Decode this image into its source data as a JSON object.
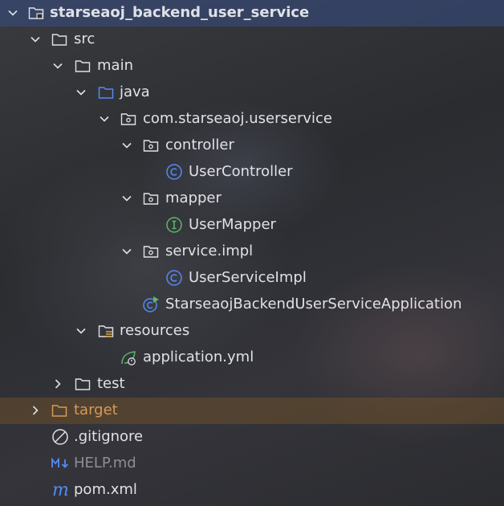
{
  "project_tree": {
    "items": [
      {
        "label": "starseaoj_backend_user_service",
        "icon": "module-folder-icon",
        "expanded": true,
        "selected": true
      },
      {
        "label": "src",
        "icon": "folder-icon",
        "expanded": true
      },
      {
        "label": "main",
        "icon": "folder-icon",
        "expanded": true
      },
      {
        "label": "java",
        "icon": "source-root-folder-icon",
        "expanded": true
      },
      {
        "label": "com.starseaoj.userservice",
        "icon": "package-icon",
        "expanded": true
      },
      {
        "label": "controller",
        "icon": "package-icon",
        "expanded": true
      },
      {
        "label": "UserController",
        "icon": "class-icon"
      },
      {
        "label": "mapper",
        "icon": "package-icon",
        "expanded": true
      },
      {
        "label": "UserMapper",
        "icon": "interface-icon"
      },
      {
        "label": "service.impl",
        "icon": "package-icon",
        "expanded": true
      },
      {
        "label": "UserServiceImpl",
        "icon": "class-icon"
      },
      {
        "label": "StarseaojBackendUserServiceApplication",
        "icon": "spring-boot-app-icon"
      },
      {
        "label": "resources",
        "icon": "resources-folder-icon",
        "expanded": true
      },
      {
        "label": "application.yml",
        "icon": "spring-config-icon"
      },
      {
        "label": "test",
        "icon": "folder-icon",
        "expanded": false
      },
      {
        "label": "target",
        "icon": "excluded-folder-icon",
        "expanded": false
      },
      {
        "label": ".gitignore",
        "icon": "ignore-file-icon"
      },
      {
        "label": "HELP.md",
        "icon": "markdown-icon"
      },
      {
        "label": "pom.xml",
        "icon": "maven-icon"
      }
    ]
  },
  "colors": {
    "selection": "#374a7d",
    "excluded_row": "#78542a",
    "class_icon": "#548af7",
    "interface_icon": "#5fb865",
    "target_text": "#d99857"
  }
}
